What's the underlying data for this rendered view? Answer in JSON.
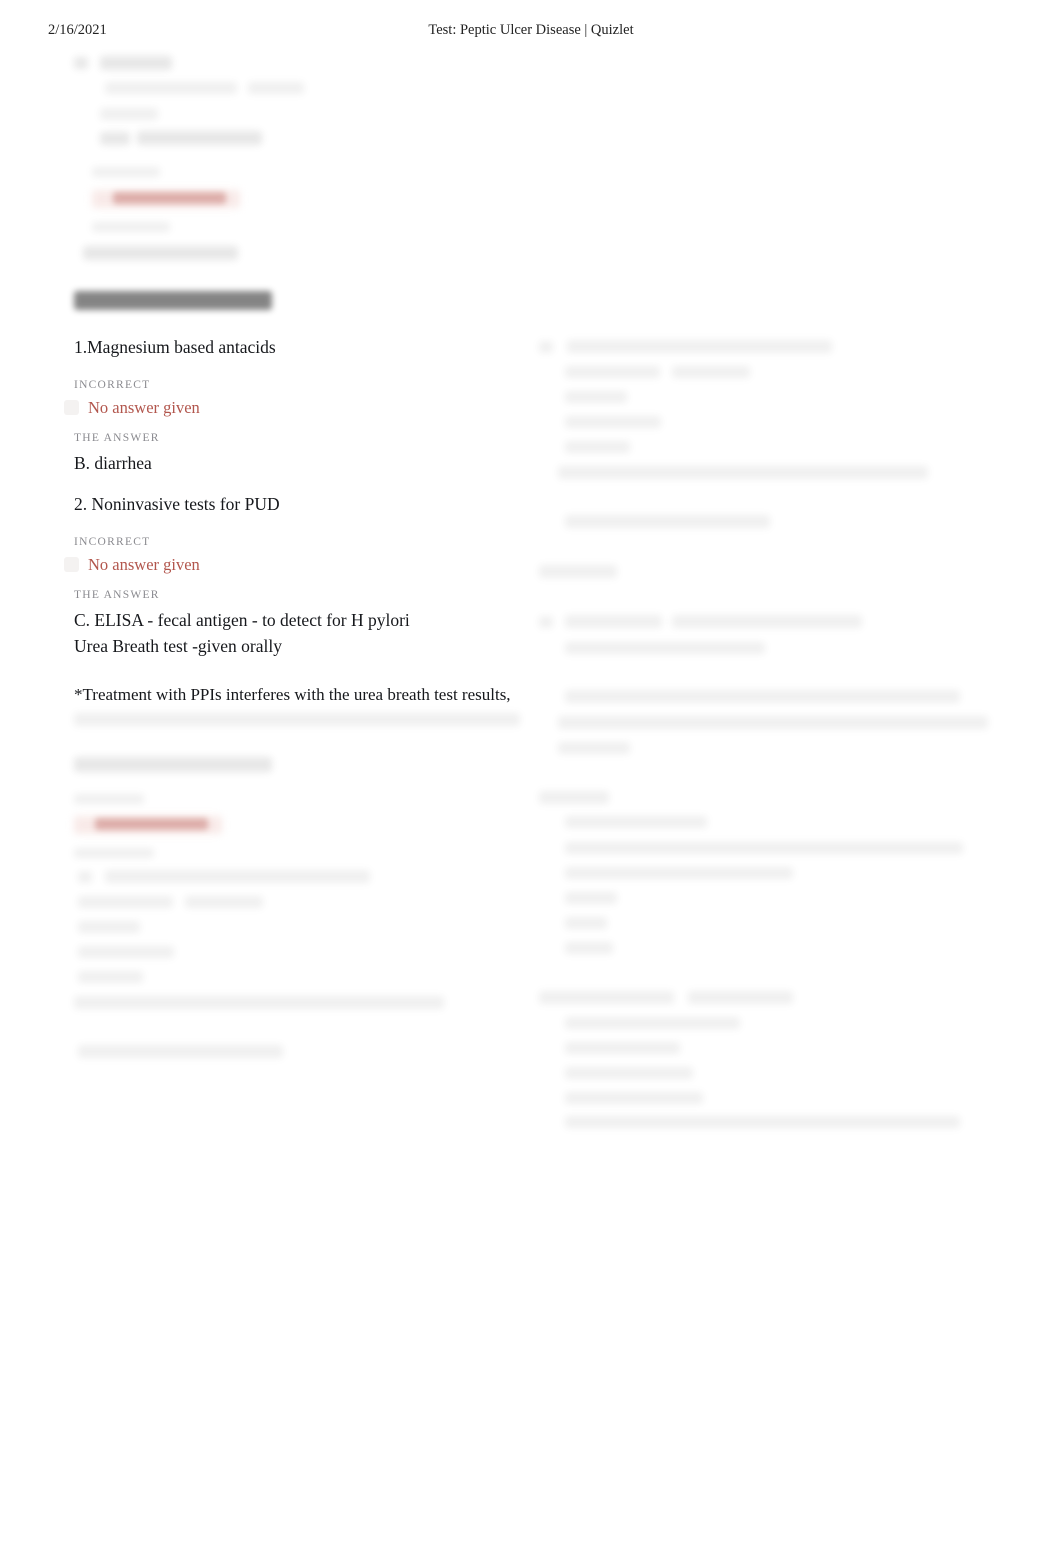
{
  "header": {
    "date": "2/16/2021",
    "document_title": "Test: Peptic Ulcer Disease | Quizlet"
  },
  "questions": [
    {
      "prompt": "1.Magnesium based antacids",
      "status_label": "INCORRECT",
      "given_answer": "No answer given",
      "answer_label": "THE ANSWER",
      "correct_answer": "B. diarrhea",
      "correct_answer_line2": ""
    },
    {
      "prompt": "2. Noninvasive tests for PUD",
      "status_label": "INCORRECT",
      "given_answer": "No answer given",
      "answer_label": "THE ANSWER",
      "correct_answer": "C. ELISA - fecal antigen - to detect for H pylori",
      "correct_answer_line2": "Urea Breath test -given orally"
    }
  ],
  "notes": {
    "ppi_note": "*Treatment with PPIs interferes with the urea breath test results,"
  },
  "colors": {
    "incorrect_red": "#b2564d",
    "status_gray": "#8a8a8f",
    "body_black": "#16181c",
    "page_background": "#ffffff"
  }
}
